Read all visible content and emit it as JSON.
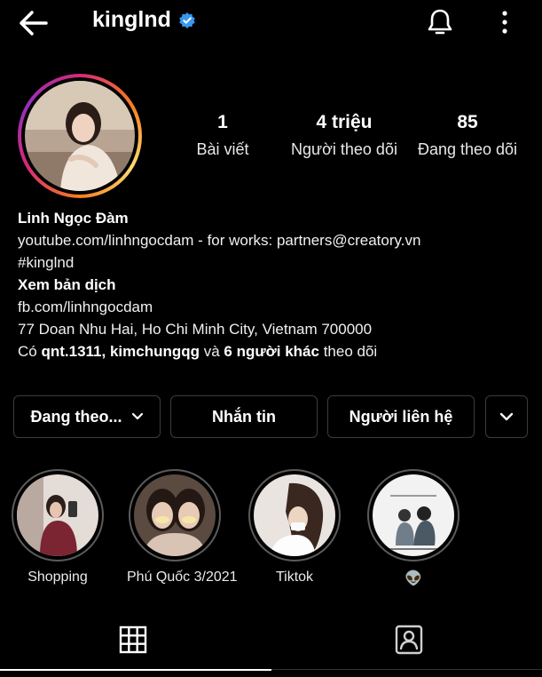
{
  "header": {
    "username": "kinglnd",
    "icons": [
      "back-arrow-icon",
      "verified-badge-icon",
      "bell-icon",
      "more-vertical-icon"
    ]
  },
  "stats": [
    {
      "value": "1",
      "label": "Bài viết"
    },
    {
      "value": "4 triệu",
      "label": "Người theo dõi"
    },
    {
      "value": "85",
      "label": "Đang theo dõi"
    }
  ],
  "bio": {
    "name": "Linh Ngọc Đàm",
    "line1": "youtube.com/linhngocdam - for works:  partners@creatory.vn",
    "hashtag": "#kinglnd",
    "translate": "Xem bản dịch",
    "link": "fb.com/linhngocdam",
    "address": "77 Doan Nhu Hai, Ho Chi Minh City, Vietnam 700000",
    "followed_by_prefix": "Có ",
    "followed_by_names": "qnt.1311, kimchungqg",
    "followed_by_mid": " và ",
    "followed_by_others": "6 người khác",
    "followed_by_suffix": " theo dõi"
  },
  "buttons": {
    "following": "Đang theo...",
    "message": "Nhắn tin",
    "contact": "Người liên hệ"
  },
  "highlights": [
    {
      "label": "Shopping"
    },
    {
      "label": "Phú Quốc 3/2021"
    },
    {
      "label": "Tiktok"
    },
    {
      "label": "👽"
    }
  ],
  "tabs": {
    "active": "grid",
    "icons": [
      "grid-icon",
      "tagged-icon"
    ]
  },
  "colors": {
    "background": "#000000",
    "text": "#ffffff",
    "verified": "#3897f0",
    "border": "#3c3c3c"
  }
}
